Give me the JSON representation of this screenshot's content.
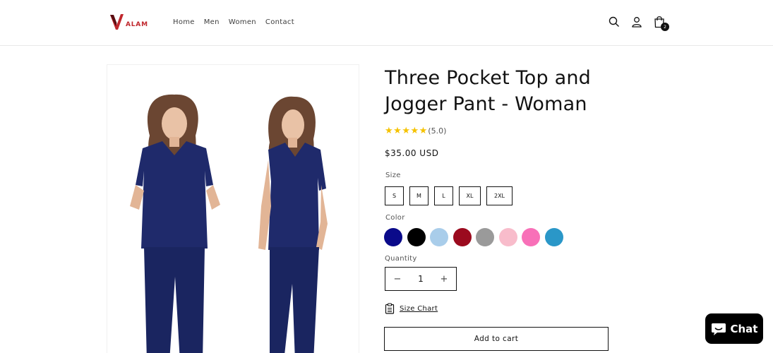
{
  "header": {
    "logo_text": "ALAM",
    "nav": [
      "Home",
      "Men",
      "Women",
      "Contact"
    ],
    "cart_count": "2"
  },
  "product": {
    "title": "Three Pocket Top and Jogger Pant - Woman",
    "rating": 5.0,
    "rating_text": "(5.0)",
    "price": "$35.00 USD",
    "size_label": "Size",
    "sizes": [
      "S",
      "M",
      "L",
      "XL",
      "2XL"
    ],
    "color_label": "Color",
    "colors": [
      "#0a0a8a",
      "#000000",
      "#a9cdea",
      "#9b0a1e",
      "#9a9a9a",
      "#f8bccb",
      "#f870b8",
      "#2a97c8"
    ],
    "quantity_label": "Quantity",
    "quantity_value": "1",
    "qty_minus": "−",
    "qty_plus": "+",
    "size_chart_label": "Size Chart",
    "add_to_cart_label": "Add to cart"
  },
  "chat": {
    "label": "Chat"
  },
  "icons": {
    "search": "search-icon",
    "account": "account-icon",
    "cart": "cart-icon",
    "size_chart": "clipboard-icon",
    "chat": "chat-bubble-icon"
  },
  "brand_colors": {
    "accent": "#c0272d",
    "star": "#f5c200",
    "scrub": "#1f2a6b"
  }
}
